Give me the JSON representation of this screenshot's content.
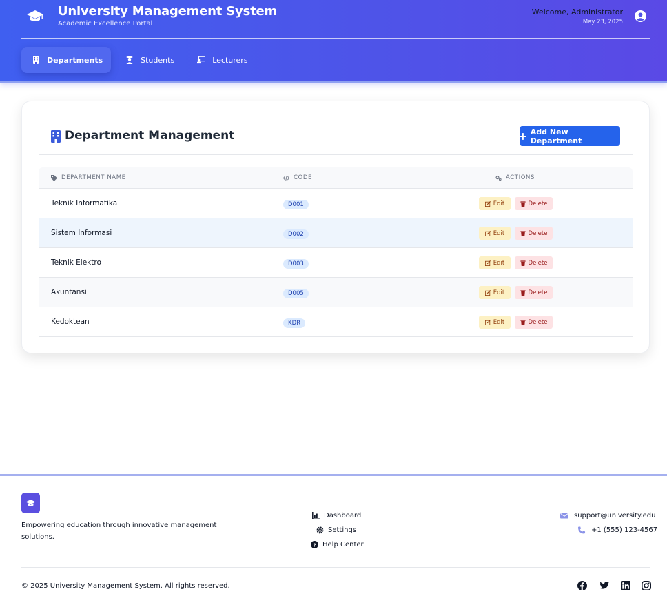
{
  "header": {
    "title": "University Management System",
    "subtitle": "Academic Excellence Portal",
    "welcome": "Welcome, Administrator",
    "date": "May 23, 2025"
  },
  "nav": [
    {
      "label": "Departments",
      "icon": "building-icon",
      "active": true
    },
    {
      "label": "Students",
      "icon": "graduate-icon",
      "active": false
    },
    {
      "label": "Lecturers",
      "icon": "chalkboard-teacher-icon",
      "active": false
    }
  ],
  "card": {
    "title": "Department Management",
    "add_button": "Add New Department"
  },
  "table": {
    "columns": [
      "DEPARTMENT NAME",
      "CODE",
      "ACTIONS"
    ],
    "rows": [
      {
        "name": "Teknik Informatika",
        "code": "D001"
      },
      {
        "name": "Sistem Informasi",
        "code": "D002"
      },
      {
        "name": "Teknik Elektro",
        "code": "D003"
      },
      {
        "name": "Akuntansi",
        "code": "D005"
      },
      {
        "name": "Kedoktean",
        "code": "KDR"
      }
    ],
    "edit_label": "Edit",
    "delete_label": "Delete"
  },
  "footer": {
    "tagline": "Empowering education through innovative management solutions.",
    "links": [
      "Dashboard",
      "Settings",
      "Help Center"
    ],
    "email": "support@university.edu",
    "phone": "+1 (555) 123-4567",
    "copyright": "© 2025 University Management System. All rights reserved.",
    "social": [
      "facebook-icon",
      "twitter-icon",
      "linkedin-icon",
      "instagram-icon"
    ]
  },
  "colors": {
    "header_start": "#3f5ff0",
    "header_end": "#5a49e6",
    "primary_button": "#2563eb",
    "code_badge_bg": "#dbeafe",
    "edit_bg": "#fdf1c4",
    "delete_bg": "#fde2e4"
  }
}
